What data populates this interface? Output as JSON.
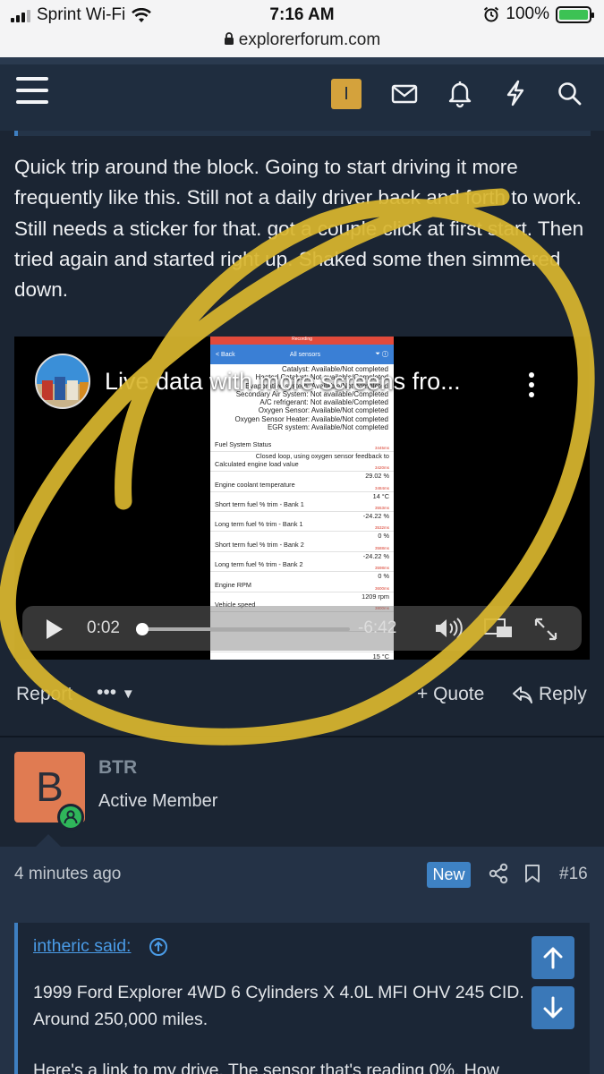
{
  "status_bar": {
    "carrier": "Sprint Wi-Fi",
    "time": "7:16 AM",
    "battery": "100%",
    "battery_level": 1.0,
    "url": "explorerforum.com"
  },
  "header": {
    "badge_letter": "I",
    "icons": [
      "menu-icon",
      "mail-icon",
      "bell-icon",
      "bolt-icon",
      "search-icon"
    ]
  },
  "post": {
    "text": "Quick trip around the block. Going to start driving it more frequently like this. Still not a daily driver back and forth to work. Still needs a sticker for that. got a couple click at first start. Then tried again and started right up. Shaked some then simmered down.",
    "video": {
      "title": "Live data with more screens fro...",
      "current_time": "0:02",
      "remaining_time": "-6:42",
      "progress": 0.005,
      "screen": {
        "recording": "Recording",
        "back": "< Back",
        "title": "All sensors",
        "tests": [
          "Catalyst: Available/Not completed",
          "Heated Catalyst: Not available/Completed",
          "Evaporative system: Available/Not completed",
          "Secondary Air System: Not available/Completed",
          "A/C refrigerant: Not available/Completed",
          "Oxygen Sensor: Available/Not completed",
          "Oxygen Sensor Heater: Available/Not completed",
          "EGR system: Available/Not completed"
        ],
        "sensors": [
          {
            "name": "Fuel System Status",
            "value": "",
            "ms": "3445ms"
          },
          {
            "name": "Calculated engine load value",
            "value": "Closed loop, using oxygen sensor feedback to",
            "ms": "3420ms"
          },
          {
            "name": "Engine coolant temperature",
            "value": "29.02 %",
            "ms": "3484ms"
          },
          {
            "name": "Short term fuel % trim - Bank 1",
            "value": "14 °C",
            "ms": "3553ms"
          },
          {
            "name": "Long term fuel % trim - Bank 1",
            "value": "-24.22 %",
            "ms": "3532ms"
          },
          {
            "name": "Short term fuel % trim - Bank 2",
            "value": "0 %",
            "ms": "3588ms"
          },
          {
            "name": "Long term fuel % trim - Bank 2",
            "value": "-24.22 %",
            "ms": "3598ms"
          },
          {
            "name": "Engine RPM",
            "value": "0 %",
            "ms": "3600ms"
          },
          {
            "name": "Vehicle speed",
            "value": "1209 rpm",
            "ms": "3800ms"
          },
          {
            "name": "",
            "value": "",
            "ms": ""
          },
          {
            "name": "",
            "value": "",
            "ms": ""
          },
          {
            "name": "",
            "value": "15 °C",
            "ms": ""
          }
        ]
      }
    },
    "actions": {
      "report": "Report",
      "more": "•••",
      "quote": "+ Quote",
      "reply": "Reply"
    }
  },
  "reply_post": {
    "avatar_letter": "B",
    "username": "BTR",
    "role": "Active Member",
    "time_ago": "4 minutes ago",
    "new_badge": "New",
    "post_number": "#16",
    "quote": {
      "author": "intheric said:",
      "line1": "1999 Ford Explorer 4WD 6 Cylinders X 4.0L MFI OHV 245 CID. Around 250,000 miles.",
      "line2": "Here's a link to my drive. The sensor that's reading 0%. How"
    }
  },
  "colors": {
    "page_bg": "#1b2533",
    "header_bg": "#1f2d3f",
    "accent_blue": "#3e82c4",
    "badge_gold": "#d4a23c",
    "scribble_yellow": "#d8b62e",
    "avatar_orange": "#e07b52",
    "online_green": "#2fb65a"
  }
}
